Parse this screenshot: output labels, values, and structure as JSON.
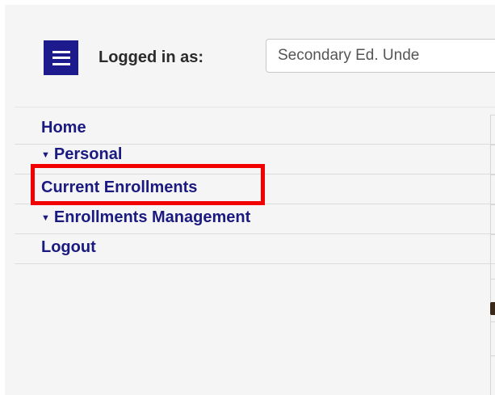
{
  "header": {
    "menu_icon": "hamburger-menu-icon",
    "logged_in_label": "Logged in as:",
    "role_value": "Secondary Ed. Unde"
  },
  "nav": {
    "items": [
      {
        "label": "Home",
        "expandable": false
      },
      {
        "label": "Personal",
        "expandable": true,
        "caret_icon": "caret-down-icon"
      },
      {
        "label": "Current Enrollments",
        "expandable": false,
        "highlighted": true
      },
      {
        "label": "Enrollments Management",
        "expandable": true,
        "caret_icon": "caret-down-icon"
      },
      {
        "label": "Logout",
        "expandable": false
      }
    ]
  },
  "colors": {
    "menu_button_bg": "#1c1a8c",
    "nav_link": "#1a1a80",
    "highlight": "#f20000",
    "background": "#f5f5f5"
  }
}
